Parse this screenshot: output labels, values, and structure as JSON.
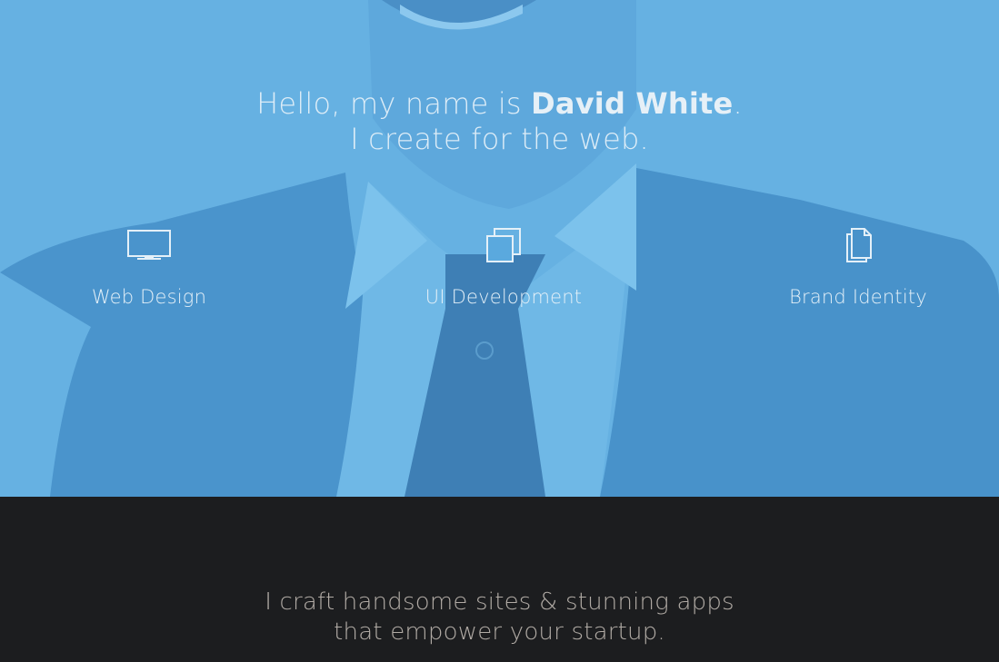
{
  "hero": {
    "greeting_prefix": "Hello, my name is ",
    "name": "David White",
    "greeting_suffix": ".",
    "subline": "I create for the web."
  },
  "services": [
    {
      "label": "Web Design",
      "icon": "monitor-icon"
    },
    {
      "label": "UI Development",
      "icon": "stacked-squares-icon"
    },
    {
      "label": "Brand Identity",
      "icon": "documents-icon"
    }
  ],
  "tagline": {
    "line1": "I craft handsome sites & stunning apps",
    "line2": "that empower your startup."
  },
  "colors": {
    "hero_overlay": "#5aa9de",
    "dark_section": "#1c1d1f",
    "tagline_text": "#b1aba5"
  }
}
